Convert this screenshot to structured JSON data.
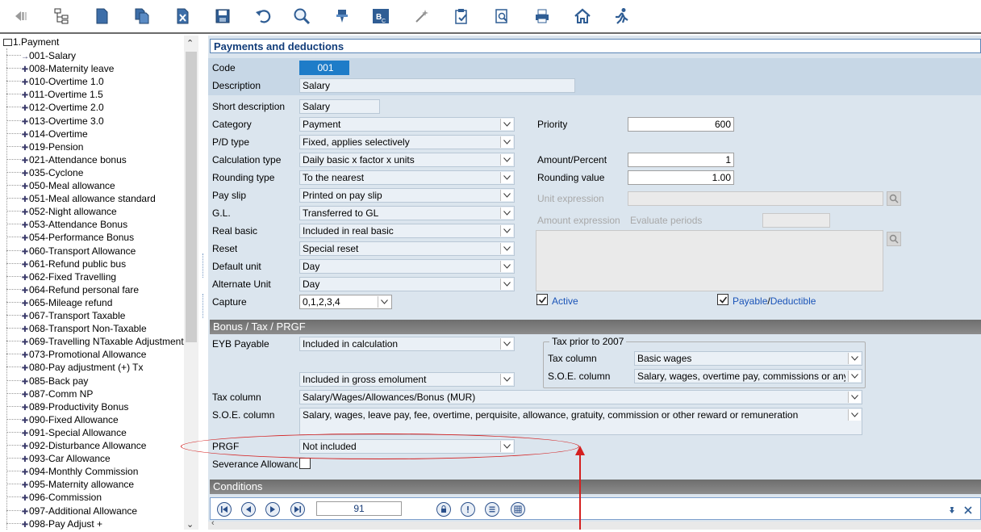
{
  "toolbar": {
    "icons": [
      "back-icon",
      "tree-icon",
      "new-document-icon",
      "copy-document-icon",
      "delete-document-icon",
      "save-icon",
      "undo-icon",
      "search-icon",
      "filter-icon",
      "field-bc-icon",
      "wand-icon",
      "clipboard-icon",
      "find-record-icon",
      "print-icon",
      "home-icon",
      "run-icon"
    ]
  },
  "tree": {
    "root": "1.Payment",
    "items": [
      "001-Salary",
      "008-Maternity leave",
      "010-Overtime 1.0",
      "011-Overtime 1.5",
      "012-Overtime 2.0",
      "013-Overtime 3.0",
      "014-Overtime",
      "019-Pension",
      "021-Attendance bonus",
      "035-Cyclone",
      "050-Meal allowance",
      "051-Meal allowance standard",
      "052-Night allowance",
      "053-Attendance Bonus",
      "054-Performance Bonus",
      "060-Transport  Allowance",
      "061-Refund public bus",
      "062-Fixed Travelling",
      "064-Refund personal fare",
      "065-Mileage refund",
      "067-Transport Taxable",
      "068-Transport Non-Taxable",
      "069-Travelling NTaxable Adjustment",
      "073-Promotional Allowance",
      "080-Pay adjustment (+) Tx",
      "085-Back pay",
      "087-Comm NP",
      "089-Productivity Bonus",
      "090-Fixed Allowance",
      "091-Special Allowance",
      "092-Disturbance Allowance",
      "093-Car Allowance",
      "094-Monthly Commission",
      "095-Maternity allowance",
      "096-Commission",
      "097-Additional Allowance",
      "098-Pay Adjust +"
    ]
  },
  "sections": {
    "main": "Payments and deductions",
    "bonus": "Bonus / Tax / PRGF",
    "conditions": "Conditions"
  },
  "form": {
    "code_label": "Code",
    "code": "001",
    "description_label": "Description",
    "description": "Salary",
    "short_description_label": "Short description",
    "short_description": "Salary",
    "category_label": "Category",
    "category": "Payment",
    "pd_type_label": "P/D type",
    "pd_type": "Fixed, applies selectively",
    "calculation_type_label": "Calculation type",
    "calculation_type": "Daily basic x factor x units",
    "rounding_type_label": "Rounding type",
    "rounding_type": "To the nearest",
    "pay_slip_label": "Pay slip",
    "pay_slip": "Printed on pay slip",
    "gl_label": "G.L.",
    "gl": "Transferred to GL",
    "real_basic_label": "Real basic",
    "real_basic": "Included in real basic",
    "reset_label": "Reset",
    "reset": "Special reset",
    "default_unit_label": "Default unit",
    "default_unit": "Day",
    "alternate_unit_label": "Alternate Unit",
    "alternate_unit": "Day",
    "capture_label": "Capture",
    "capture": "0,1,2,3,4",
    "priority_label": "Priority",
    "priority": "600",
    "amount_percent_label": "Amount/Percent",
    "amount_percent": "1",
    "rounding_value_label": "Rounding value",
    "rounding_value": "1.00",
    "unit_expression_label": "Unit expression",
    "amount_expression_label": "Amount expression",
    "evaluate_periods_label": "Evaluate periods",
    "active_label": "Active",
    "payable_label": "Payable",
    "slash": "/",
    "deductible_label": "Deductible"
  },
  "bonus": {
    "eyb_payable_label": "EYB Payable",
    "eyb_payable": "Included in calculation",
    "gross_emolument": "Included in gross emolument",
    "tax_prior_title": "Tax prior to 2007",
    "tax_prior_column_label": "Tax column",
    "tax_prior_column": "Basic wages",
    "tax_prior_soe_label": "S.O.E. column",
    "tax_prior_soe": "Salary, wages, overtime pay, commissions or any ot",
    "tax_column_label": "Tax column",
    "tax_column": "Salary/Wages/Allowances/Bonus (MUR)",
    "soe_column_label": "S.O.E. column",
    "soe_column": "Salary, wages, leave pay, fee, overtime, perquisite, allowance, gratuity, commission or other reward or remuneration",
    "prgf_label": "PRGF",
    "prgf": "Not included",
    "severance_label": "Severance Allowanc"
  },
  "navigation": {
    "record": "91"
  },
  "colors": {
    "panel": "#dbe5ee",
    "code_highlight": "#1e7cc8",
    "annotation": "#d42020",
    "section_header": "#7a7a7a"
  }
}
